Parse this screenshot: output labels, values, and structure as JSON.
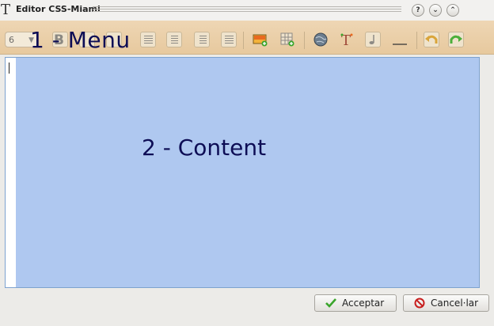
{
  "window": {
    "title": "Editor CSS-Miami",
    "app_icon_glyph": "T",
    "controls": {
      "help": "?",
      "minimize": "⌄",
      "maximize": "⌃"
    }
  },
  "toolbar": {
    "font_size_value": "6",
    "menu_overlay_label": "1 - Menu",
    "bold_glyph": "B",
    "icons": [
      "bold-icon",
      "align-left-icon",
      "align-center-icon",
      "align-right-icon",
      "align-justify-icon",
      "insert-image-icon",
      "insert-table-icon",
      "globe-link-icon",
      "text-style-icon",
      "music-note-icon",
      "horizontal-rule-icon",
      "undo-icon",
      "redo-icon"
    ]
  },
  "editor": {
    "content_overlay_label": "2 - Content",
    "content_background": "#afc8f0",
    "border_color": "#7da2cf"
  },
  "buttons": {
    "accept_label": "Acceptar",
    "cancel_label": "Cancel·lar"
  },
  "colors": {
    "toolbar_bg": "#e9cfa8",
    "accept_check": "#3aa52b",
    "cancel_icon": "#c81e1e",
    "label_text": "#0d0d55"
  }
}
